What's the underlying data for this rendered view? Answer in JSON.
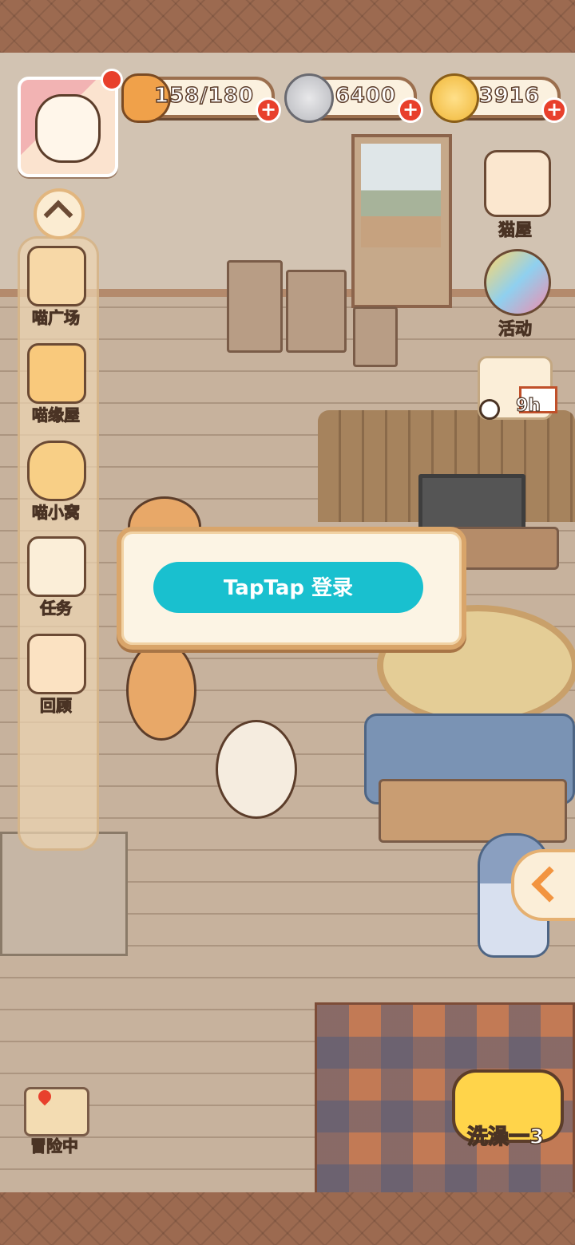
{
  "resources": {
    "fish": {
      "value": "158/180",
      "icon": "fish-icon"
    },
    "yarn_grey": {
      "value": "6400",
      "icon": "grey-yarn-icon"
    },
    "yarn_gold": {
      "value": "3916",
      "icon": "gold-yarn-icon"
    },
    "plus": "+"
  },
  "sidebar": {
    "items": [
      {
        "label": "喵广场",
        "icon": "plaza-icon"
      },
      {
        "label": "喵缘屋",
        "icon": "paw-house-icon"
      },
      {
        "label": "喵小窝",
        "icon": "cat-nest-icon"
      },
      {
        "label": "任务",
        "icon": "task-list-icon"
      },
      {
        "label": "回顾",
        "icon": "clapperboard-icon"
      }
    ]
  },
  "right_menu": {
    "cat_house": "猫屋",
    "events": "活动",
    "timer": "9h"
  },
  "bottom": {
    "adventure": "冒险中",
    "bath": "洗澡一3"
  },
  "modal": {
    "login_button": "TapTap 登录",
    "accent": "#19c0cf"
  }
}
